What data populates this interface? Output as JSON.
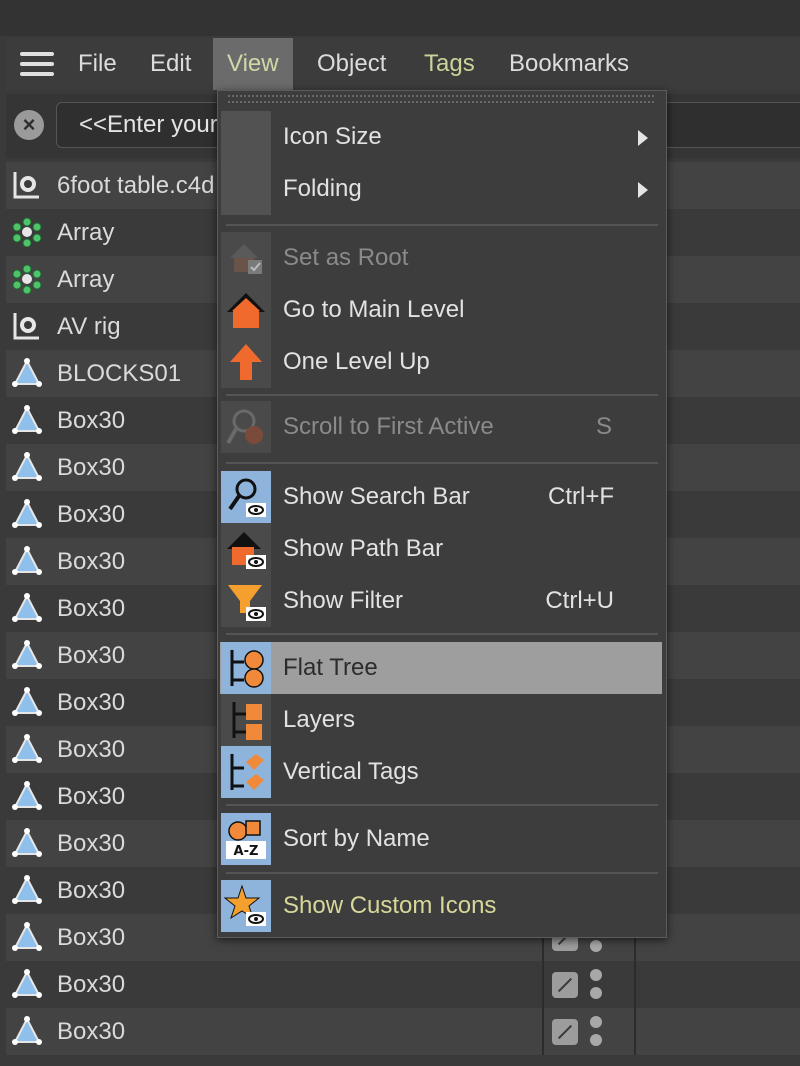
{
  "menubar": {
    "items": [
      {
        "label": "File"
      },
      {
        "label": "Edit"
      },
      {
        "label": "View"
      },
      {
        "label": "Object"
      },
      {
        "label": "Tags"
      },
      {
        "label": "Bookmarks"
      }
    ]
  },
  "search": {
    "placeholder": "<<Enter your search string>>"
  },
  "objects": [
    {
      "name": "6foot table.c4d",
      "icon": "null-object-icon"
    },
    {
      "name": "Array",
      "icon": "array-icon"
    },
    {
      "name": "Array",
      "icon": "array-icon"
    },
    {
      "name": "AV rig",
      "icon": "null-object-icon"
    },
    {
      "name": "BLOCKS01",
      "icon": "polygon-object-icon"
    },
    {
      "name": "Box30",
      "icon": "polygon-object-icon"
    },
    {
      "name": "Box30",
      "icon": "polygon-object-icon"
    },
    {
      "name": "Box30",
      "icon": "polygon-object-icon"
    },
    {
      "name": "Box30",
      "icon": "polygon-object-icon"
    },
    {
      "name": "Box30",
      "icon": "polygon-object-icon"
    },
    {
      "name": "Box30",
      "icon": "polygon-object-icon"
    },
    {
      "name": "Box30",
      "icon": "polygon-object-icon"
    },
    {
      "name": "Box30",
      "icon": "polygon-object-icon"
    },
    {
      "name": "Box30",
      "icon": "polygon-object-icon"
    },
    {
      "name": "Box30",
      "icon": "polygon-object-icon"
    },
    {
      "name": "Box30",
      "icon": "polygon-object-icon"
    },
    {
      "name": "Box30",
      "icon": "polygon-object-icon"
    },
    {
      "name": "Box30",
      "icon": "polygon-object-icon"
    },
    {
      "name": "Box30",
      "icon": "polygon-object-icon"
    }
  ],
  "view_menu": {
    "icon_size": "Icon Size",
    "folding": "Folding",
    "set_as_root": "Set as Root",
    "go_to_main_level": "Go to Main Level",
    "one_level_up": "One Level Up",
    "scroll_to_first_active": "Scroll to First Active",
    "scroll_shortcut": "S",
    "show_search_bar": "Show Search Bar",
    "search_shortcut": "Ctrl+F",
    "show_path_bar": "Show Path Bar",
    "show_filter": "Show Filter",
    "filter_shortcut": "Ctrl+U",
    "flat_tree": "Flat Tree",
    "layers": "Layers",
    "vertical_tags": "Vertical Tags",
    "sort_by_name": "Sort by Name",
    "sort_icon_text": "A-Z",
    "show_custom_icons": "Show Custom Icons"
  },
  "colors": {
    "accent_orange": "#f0883a",
    "icon_blue": "#8fb4dc",
    "highlight": "#9e9e9e",
    "active_menu_text": "#cfd9a8"
  }
}
